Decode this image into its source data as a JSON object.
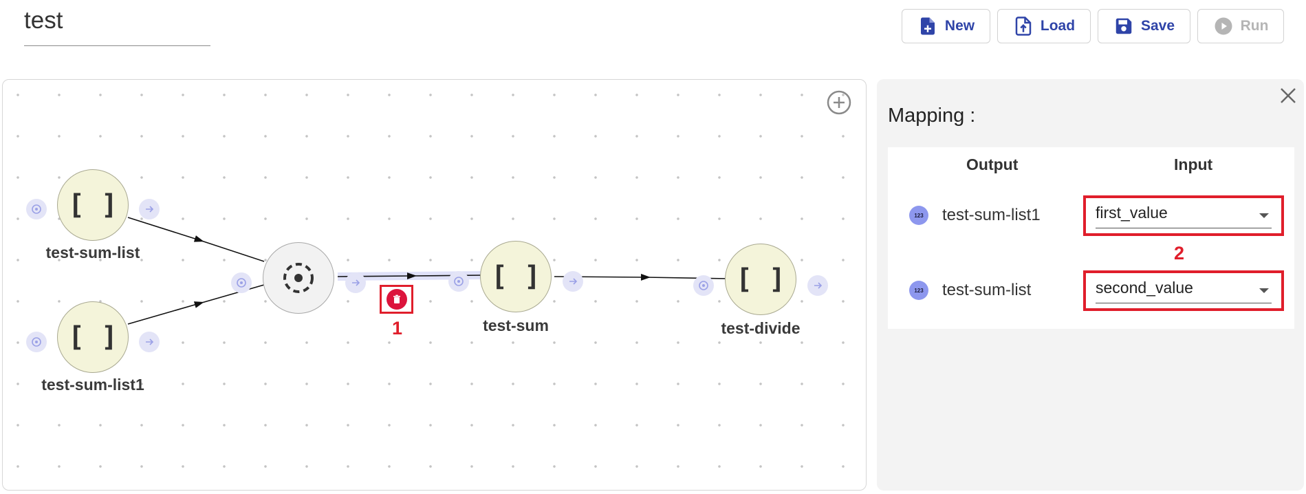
{
  "header": {
    "workflow_name": "test",
    "buttons": {
      "new": "New",
      "load": "Load",
      "save": "Save",
      "run": "Run"
    },
    "run_disabled": true
  },
  "canvas": {
    "nodes": [
      {
        "label": "test-sum-list",
        "glyph": "[ ]"
      },
      {
        "label": "test-sum-list1",
        "glyph": "[ ]"
      },
      {
        "label": "",
        "glyph": "merge-icon"
      },
      {
        "label": "test-sum",
        "glyph": "[ ]"
      },
      {
        "label": "test-divide",
        "glyph": "[ ]"
      }
    ],
    "annotations": {
      "delete_marker": "1",
      "select_marker": "2"
    }
  },
  "mapping_panel": {
    "title": "Mapping :",
    "columns": {
      "output": "Output",
      "input": "Input"
    },
    "rows": [
      {
        "type_badge": "123",
        "output": "test-sum-list1",
        "input": "first_value"
      },
      {
        "type_badge": "123",
        "output": "test-sum-list",
        "input": "second_value"
      }
    ]
  },
  "colors": {
    "accent": "#2f44a8",
    "node_fill": "#f4f4da",
    "port_fill": "#e3e4f7",
    "delete_red": "#dc143c",
    "annotation_red": "#e01e2b",
    "badge": "#8d97ee"
  }
}
